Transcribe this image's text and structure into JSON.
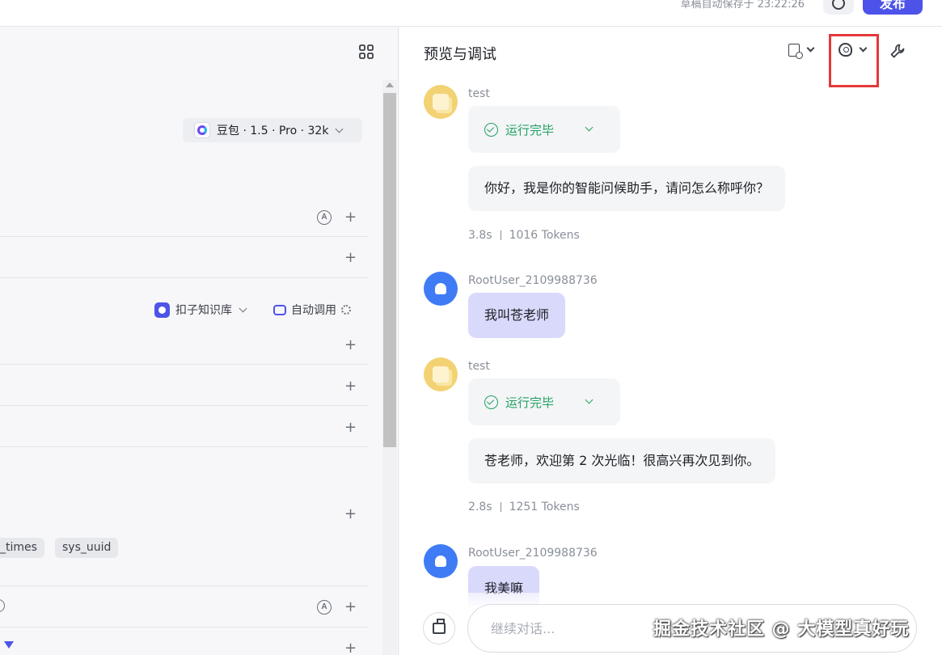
{
  "topbar": {
    "autosave_text": "草稿自动保存于 23:22:26",
    "publish_label": "发布"
  },
  "left": {
    "model_label": "豆包 · 1.5 · Pro · 32k",
    "knowledge_label": "扣子知识库",
    "auto_call_label": "自动调用",
    "a_icon_text": "A",
    "var_tags": [
      "_times",
      "sys_uuid"
    ]
  },
  "right": {
    "title": "预览与调试",
    "messages": [
      {
        "sender": "test",
        "status": "运行完毕",
        "reply": "你好，我是你的智能问候助手，请问怎么称呼你？",
        "time": "3.8s",
        "tokens": "1016 Tokens"
      },
      {
        "sender": "RootUser_2109988736",
        "text": "我叫苍老师"
      },
      {
        "sender": "test",
        "status": "运行完毕",
        "reply": "苍老师，欢迎第 2 次光临！很高兴再次见到你。",
        "time": "2.8s",
        "tokens": "1251 Tokens"
      },
      {
        "sender": "RootUser_2109988736",
        "text": "我美嘛"
      }
    ],
    "input_placeholder": "继续对话..."
  },
  "watermark": "掘金技术社区 @ 大模型真好玩",
  "colors": {
    "accent": "#4d53e8",
    "success": "#22a163",
    "highlight": "#e5383b"
  }
}
